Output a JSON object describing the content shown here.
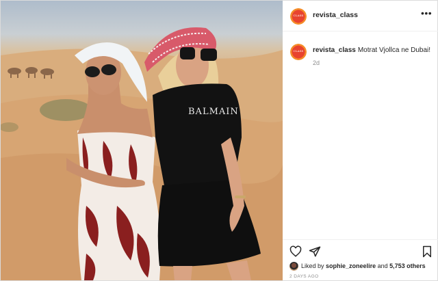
{
  "post": {
    "username": "revista_class",
    "avatar_text": "CLASS",
    "more_label": "•••",
    "caption_username": "revista_class",
    "caption_text": "Motrat Vjollca ne Dubai!",
    "time_ago": "2d",
    "liked_by_prefix": "Liked by",
    "liked_by_user": "sophie_zoneelire",
    "liked_by_and": "and",
    "likes_count": "5,753 others",
    "date": "2 DAYS AGO",
    "shirt_text": "BALMAIN"
  },
  "colors": {
    "sand": "#d49d6b",
    "sky": "#aebccb",
    "avatar_ring": "#f58d2a",
    "muted_text": "#8e8e8e"
  },
  "icons": [
    "more-options-icon",
    "heart-icon",
    "share-icon",
    "bookmark-icon"
  ]
}
